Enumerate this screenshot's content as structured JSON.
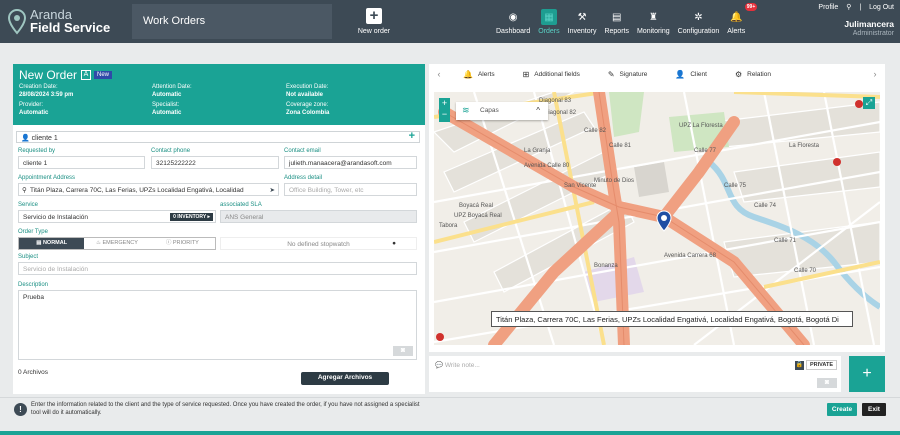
{
  "brand": {
    "line1": "Aranda",
    "line2": "Field Service"
  },
  "module_title": "Work Orders",
  "new_order_label": "New order",
  "nav": [
    {
      "label": "Dashboard",
      "icon": "dashboard-icon",
      "glyph": "◉"
    },
    {
      "label": "Orders",
      "icon": "calendar-icon",
      "glyph": "▦",
      "active": true
    },
    {
      "label": "Inventory",
      "icon": "tools-icon",
      "glyph": "⚒"
    },
    {
      "label": "Reports",
      "icon": "report-icon",
      "glyph": "▤"
    },
    {
      "label": "Monitoring",
      "icon": "tower-icon",
      "glyph": "♜"
    },
    {
      "label": "Configuration",
      "icon": "gear-icon",
      "glyph": "✲"
    },
    {
      "label": "Alerts",
      "icon": "bell-icon",
      "glyph": "🔔",
      "badge": "99+"
    }
  ],
  "user": {
    "profile": "Profile",
    "logout": "Log Out",
    "name": "Julimancera",
    "role": "Administrator"
  },
  "order": {
    "title": "New Order",
    "tag_letter": "A",
    "tag_new": "New",
    "creation_date_label": "Creation Date:",
    "creation_date": "28/08/2024 3:59 pm",
    "attention_date_label": "Attention Date:",
    "attention_date": "Automatic",
    "execution_date_label": "Execution Date:",
    "execution_date": "Not available",
    "provider_label": "Provider:",
    "provider": "Automatic",
    "specialist_label": "Specialist:",
    "specialist": "Automatic",
    "coverage_label": "Coverage zone:",
    "coverage": "Zona Colombia"
  },
  "form": {
    "client": "cliente 1",
    "requested_by_label": "Requested by",
    "requested_by": "cliente 1",
    "contact_phone_label": "Contact phone",
    "contact_phone": "32125222222",
    "contact_email_label": "Contact email",
    "contact_email": "julieth.manaacera@arandasoft.com",
    "appointment_label": "Appointment Address",
    "appointment": "Titán Plaza, Carrera 70C, Las Ferias, UPZs Localidad Engativá, Localidad",
    "address_detail_label": "Address detail",
    "address_detail_placeholder": "Office Building, Tower, etc",
    "service_label": "Service",
    "service": "Servicio de Instalación",
    "inventory_btn": "0 INVENTORY ▸",
    "sla_label": "associated SLA",
    "sla": "ANS General",
    "order_type_label": "Order Type",
    "order_types": [
      "NORMAL",
      "EMERGENCY",
      "PRIORITY"
    ],
    "stopwatch": "No defined stopwatch",
    "subject_label": "Subject",
    "subject_placeholder": "Servicio de Instalación",
    "description_label": "Description",
    "description": "Prueba",
    "files_count": "0 Archivos",
    "add_files": "Agregar Archivos"
  },
  "tabs": [
    {
      "label": "Alerts",
      "icon": "bell-icon",
      "glyph": "🔔"
    },
    {
      "label": "Additional fields",
      "icon": "plus-box-icon",
      "glyph": "⊞"
    },
    {
      "label": "Signature",
      "icon": "pen-icon",
      "glyph": "✎"
    },
    {
      "label": "Client",
      "icon": "user-icon",
      "glyph": "👤"
    },
    {
      "label": "Relation",
      "icon": "network-icon",
      "glyph": "⚙"
    }
  ],
  "map": {
    "layers_label": "Capas",
    "tooltip": "Titán Plaza, Carrera 70C, Las Ferias, UPZs Localidad Engativá, Localidad Engativá, Bogotá, Bogotá Di",
    "labels": [
      "Diagonal 83",
      "Diagonal 82",
      "Calle 82",
      "Calle 81",
      "Minuto de Dios",
      "San Vicente",
      "La Granja",
      "UPZ La Floresta",
      "La Floresta",
      "Boyacá Real",
      "Tabora",
      "Bonanza",
      "UPZ Boyacá Real",
      "Avenida Calle 80",
      "Avenida Carrera 68",
      "Calle 77",
      "Calle 75",
      "Calle 74",
      "Calle 71",
      "Calle 70"
    ]
  },
  "note": {
    "placeholder": "Write note...",
    "private": "PRIVATE"
  },
  "footer": {
    "info": "Enter the information related to the client and the type of service requested. Once you have created the order, if you have not assigned a specialist tool will do it automatically.",
    "create": "Create",
    "exit": "Exit"
  },
  "colors": {
    "accent": "#1aa395",
    "topbar": "#3d4a55",
    "alert": "#e5303b"
  }
}
